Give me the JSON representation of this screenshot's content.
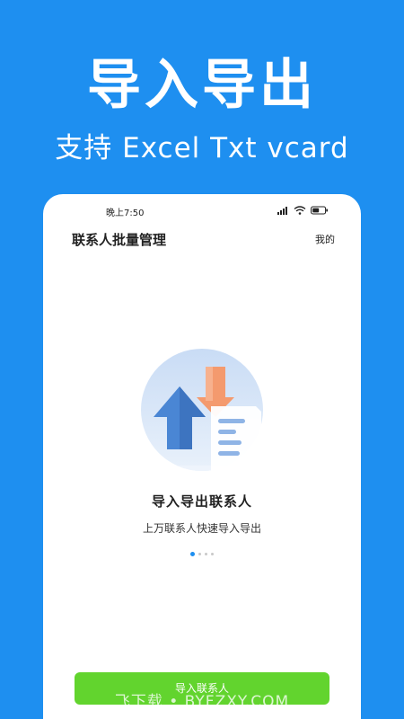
{
  "banner": {
    "title": "导入导出",
    "subtitle": "支持 Excel Txt vcard"
  },
  "status_bar": {
    "time": "晚上7:50",
    "icons": [
      "hd-signal-icon",
      "wifi-icon",
      "battery-icon"
    ]
  },
  "header": {
    "title": "联系人批量管理",
    "mine_label": "我的"
  },
  "onboarding": {
    "title": "导入导出联系人",
    "description": "上万联系人快速导入导出",
    "page_count": 4,
    "active_page": 1
  },
  "action": {
    "import_label": "导入联系人"
  },
  "watermark": {
    "text": "飞下载 • BYFZXY.COM"
  },
  "colors": {
    "background": "#1e8ff0",
    "button": "#62d42e",
    "active_dot": "#1e8ff0",
    "arrow_blue": "#4a86d4",
    "arrow_orange": "#f49a6e"
  }
}
